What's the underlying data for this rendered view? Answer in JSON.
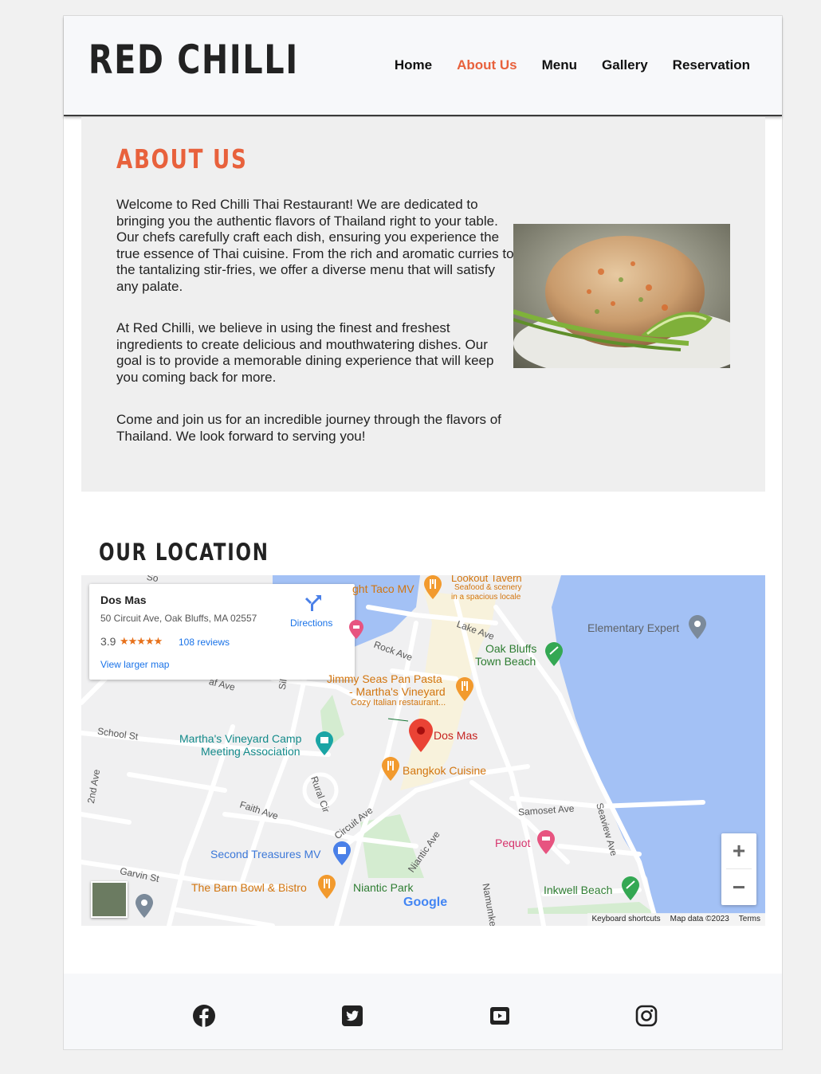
{
  "header": {
    "logo": "RED CHILLI",
    "nav": [
      "Home",
      "About Us",
      "Menu",
      "Gallery",
      "Reservation"
    ],
    "active_nav": "About Us",
    "accent_color": "#e8613c"
  },
  "about": {
    "title": "ABOUT US",
    "paragraphs": [
      "Welcome to Red Chilli Thai Restaurant! We are dedicated to bringing you the authentic flavors of Thailand right to your table. Our chefs carefully craft each dish, ensuring you experience the true essence of Thai cuisine. From the rich and aromatic curries to the tantalizing stir-fries, we offer a diverse menu that will satisfy any palate.",
      "At Red Chilli, we believe in using the finest and freshest ingredients to create delicious and mouthwatering dishes. Our goal is to provide a memorable dining experience that will keep you coming back for more.",
      "Come and join us for an incredible journey through the flavors of Thailand. We look forward to serving you!"
    ]
  },
  "location": {
    "title": "OUR LOCATION",
    "card": {
      "name": "Dos Mas",
      "address": "50 Circuit Ave, Oak Bluffs, MA 02557",
      "rating": "3.9",
      "stars": "★★★★★",
      "reviews": "108 reviews",
      "directions": "Directions",
      "larger_map": "View larger map"
    },
    "places": {
      "taco": "ght Taco MV",
      "lookout": "Lookout Tavern",
      "lookout_sub1": "Seafood & scenery",
      "lookout_sub2": "in a spacious locale",
      "elementary": "Elementary Expert",
      "oak_bluffs1": "Oak Bluffs",
      "oak_bluffs2": "Town Beach",
      "jimmy1": "Jimmy Seas Pan Pasta",
      "jimmy2": "- Martha's Vineyard",
      "jimmy3": "Cozy Italian restaurant...",
      "dos_mas": "Dos Mas",
      "camp1": "Martha's Vineyard Camp",
      "camp2": "Meeting Association",
      "bangkok": "Bangkok Cuisine",
      "pequot": "Pequot",
      "second": "Second Treasures MV",
      "barn": "The Barn Bowl & Bistro",
      "niantic": "Niantic Park",
      "inkwell": "Inkwell Beach"
    },
    "streets": {
      "lake": "Lake Ave",
      "rock": "Rock Ave",
      "school": "School St",
      "second_ave": "2nd Ave",
      "faith": "Faith Ave",
      "rural": "Rural Cir",
      "circuit": "Circuit Ave",
      "samoset": "Samoset Ave",
      "seaview": "Seaview Ave",
      "garvin": "Garvin St",
      "niantic_ave": "Niantic Ave",
      "namumkeag": "Namumkea",
      "sil": "Sil",
      "haf": "af Ave",
      "so": "So"
    },
    "google_logo": "Google",
    "attribution": [
      "Keyboard shortcuts",
      "Map data ©2023",
      "Terms"
    ],
    "zoom_in": "+",
    "zoom_out": "−"
  },
  "footer": {
    "social_icons": [
      "facebook-icon",
      "twitter-icon",
      "youtube-icon",
      "instagram-icon"
    ]
  }
}
